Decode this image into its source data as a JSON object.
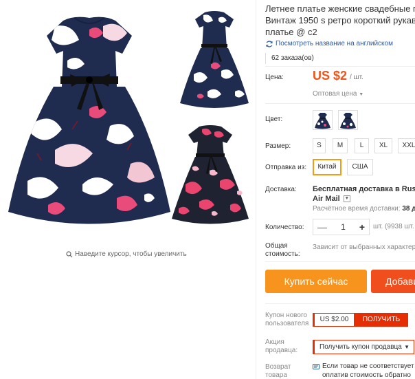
{
  "gallery": {
    "zoom_hint": "Наведите курсор, чтобы увеличить"
  },
  "product": {
    "title_lines": [
      "Летнее платье женские свадебные пл",
      "Винтаж 1950 s ретро короткий рукав в",
      "платье @ c2"
    ],
    "translate_link": "Посмотреть название на английском",
    "orders": "62 заказа(ов)"
  },
  "price": {
    "label": "Цена:",
    "value": "US $2",
    "unit": "/ шт.",
    "wholesale": "Оптовая цена"
  },
  "color": {
    "label": "Цвет:"
  },
  "size": {
    "label": "Размер:",
    "options": [
      "S",
      "M",
      "L",
      "XL",
      "XXL"
    ]
  },
  "ship_from": {
    "label": "Отправка из:",
    "options": [
      "Китай",
      "США"
    ],
    "selected": "Китай"
  },
  "delivery": {
    "label": "Доставка:",
    "line1": "Бесплатная доставка в Russian",
    "line2": "Air Mail",
    "eta_label": "Расчётное время доставки:",
    "eta_value": "38 д"
  },
  "quantity": {
    "label": "Количество:",
    "value": "1",
    "minus": "—",
    "plus": "+",
    "stock": "шт. (9938 шт."
  },
  "total": {
    "label_line1": "Общая",
    "label_line2": "стоимость:",
    "value": "Зависит от выбранных характер"
  },
  "actions": {
    "buy_now": "Купить сейчас",
    "add_to_cart": "Добави"
  },
  "coupon": {
    "label_line1": "Купон нового",
    "label_line2": "пользователя",
    "value": "US $2.00",
    "get": "ПОЛУЧИТЬ"
  },
  "promo": {
    "label_line1": "Акция",
    "label_line2": "продавца:",
    "select": "Получить купон продавца"
  },
  "returns": {
    "label_line1": "Возврат",
    "label_line2": "товара",
    "text_line1": "Если товар не соответствует",
    "text_line2": "оплатив стоимость обратно"
  },
  "colors": {
    "accent_orange": "#f7941d",
    "price_red": "#f0541d",
    "cart_red": "#f04e1c",
    "coupon_red": "#e62e04",
    "link_blue": "#2a5ba6",
    "dress_navy": "#1f2b4f"
  }
}
